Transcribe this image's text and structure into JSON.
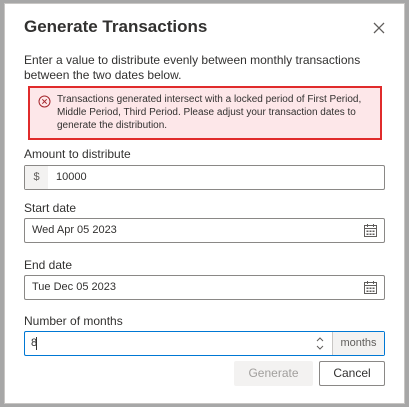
{
  "dialog": {
    "title": "Generate Transactions",
    "description": "Enter a value to distribute evenly between monthly transactions between the two dates below.",
    "error_message": "Transactions generated intersect with a locked period of First Period, Middle Period, Third Period. Please adjust your transaction dates to generate the distribution.",
    "amount": {
      "label": "Amount to distribute",
      "prefix": "$",
      "value": "10000"
    },
    "start_date": {
      "label": "Start date",
      "value": "Wed Apr 05 2023"
    },
    "end_date": {
      "label": "End date",
      "value": "Tue Dec 05 2023"
    },
    "months": {
      "label": "Number of months",
      "value": "8",
      "suffix": "months"
    },
    "buttons": {
      "generate": "Generate",
      "cancel": "Cancel"
    }
  },
  "icons": {
    "close": "close-icon",
    "error": "error-circle-icon",
    "calendar": "calendar-icon",
    "spinner": "spinner-arrows-icon"
  },
  "colors": {
    "error_border": "#e02b2b",
    "error_background": "#fde7e9",
    "focus_border": "#0078d4"
  }
}
